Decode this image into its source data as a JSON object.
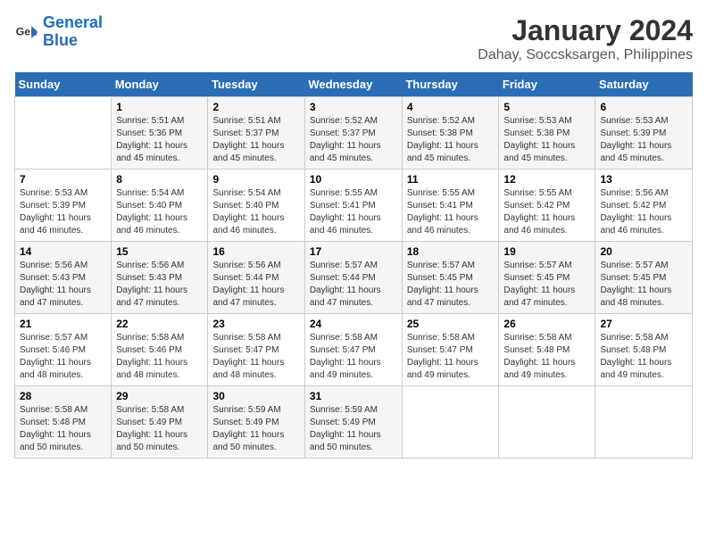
{
  "logo": {
    "line1": "General",
    "line2": "Blue"
  },
  "title": "January 2024",
  "subtitle": "Dahay, Soccsksargen, Philippines",
  "days_of_week": [
    "Sunday",
    "Monday",
    "Tuesday",
    "Wednesday",
    "Thursday",
    "Friday",
    "Saturday"
  ],
  "weeks": [
    [
      {
        "num": "",
        "info": ""
      },
      {
        "num": "1",
        "info": "Sunrise: 5:51 AM\nSunset: 5:36 PM\nDaylight: 11 hours\nand 45 minutes."
      },
      {
        "num": "2",
        "info": "Sunrise: 5:51 AM\nSunset: 5:37 PM\nDaylight: 11 hours\nand 45 minutes."
      },
      {
        "num": "3",
        "info": "Sunrise: 5:52 AM\nSunset: 5:37 PM\nDaylight: 11 hours\nand 45 minutes."
      },
      {
        "num": "4",
        "info": "Sunrise: 5:52 AM\nSunset: 5:38 PM\nDaylight: 11 hours\nand 45 minutes."
      },
      {
        "num": "5",
        "info": "Sunrise: 5:53 AM\nSunset: 5:38 PM\nDaylight: 11 hours\nand 45 minutes."
      },
      {
        "num": "6",
        "info": "Sunrise: 5:53 AM\nSunset: 5:39 PM\nDaylight: 11 hours\nand 45 minutes."
      }
    ],
    [
      {
        "num": "7",
        "info": "Sunrise: 5:53 AM\nSunset: 5:39 PM\nDaylight: 11 hours\nand 46 minutes."
      },
      {
        "num": "8",
        "info": "Sunrise: 5:54 AM\nSunset: 5:40 PM\nDaylight: 11 hours\nand 46 minutes."
      },
      {
        "num": "9",
        "info": "Sunrise: 5:54 AM\nSunset: 5:40 PM\nDaylight: 11 hours\nand 46 minutes."
      },
      {
        "num": "10",
        "info": "Sunrise: 5:55 AM\nSunset: 5:41 PM\nDaylight: 11 hours\nand 46 minutes."
      },
      {
        "num": "11",
        "info": "Sunrise: 5:55 AM\nSunset: 5:41 PM\nDaylight: 11 hours\nand 46 minutes."
      },
      {
        "num": "12",
        "info": "Sunrise: 5:55 AM\nSunset: 5:42 PM\nDaylight: 11 hours\nand 46 minutes."
      },
      {
        "num": "13",
        "info": "Sunrise: 5:56 AM\nSunset: 5:42 PM\nDaylight: 11 hours\nand 46 minutes."
      }
    ],
    [
      {
        "num": "14",
        "info": "Sunrise: 5:56 AM\nSunset: 5:43 PM\nDaylight: 11 hours\nand 47 minutes."
      },
      {
        "num": "15",
        "info": "Sunrise: 5:56 AM\nSunset: 5:43 PM\nDaylight: 11 hours\nand 47 minutes."
      },
      {
        "num": "16",
        "info": "Sunrise: 5:56 AM\nSunset: 5:44 PM\nDaylight: 11 hours\nand 47 minutes."
      },
      {
        "num": "17",
        "info": "Sunrise: 5:57 AM\nSunset: 5:44 PM\nDaylight: 11 hours\nand 47 minutes."
      },
      {
        "num": "18",
        "info": "Sunrise: 5:57 AM\nSunset: 5:45 PM\nDaylight: 11 hours\nand 47 minutes."
      },
      {
        "num": "19",
        "info": "Sunrise: 5:57 AM\nSunset: 5:45 PM\nDaylight: 11 hours\nand 47 minutes."
      },
      {
        "num": "20",
        "info": "Sunrise: 5:57 AM\nSunset: 5:45 PM\nDaylight: 11 hours\nand 48 minutes."
      }
    ],
    [
      {
        "num": "21",
        "info": "Sunrise: 5:57 AM\nSunset: 5:46 PM\nDaylight: 11 hours\nand 48 minutes."
      },
      {
        "num": "22",
        "info": "Sunrise: 5:58 AM\nSunset: 5:46 PM\nDaylight: 11 hours\nand 48 minutes."
      },
      {
        "num": "23",
        "info": "Sunrise: 5:58 AM\nSunset: 5:47 PM\nDaylight: 11 hours\nand 48 minutes."
      },
      {
        "num": "24",
        "info": "Sunrise: 5:58 AM\nSunset: 5:47 PM\nDaylight: 11 hours\nand 49 minutes."
      },
      {
        "num": "25",
        "info": "Sunrise: 5:58 AM\nSunset: 5:47 PM\nDaylight: 11 hours\nand 49 minutes."
      },
      {
        "num": "26",
        "info": "Sunrise: 5:58 AM\nSunset: 5:48 PM\nDaylight: 11 hours\nand 49 minutes."
      },
      {
        "num": "27",
        "info": "Sunrise: 5:58 AM\nSunset: 5:48 PM\nDaylight: 11 hours\nand 49 minutes."
      }
    ],
    [
      {
        "num": "28",
        "info": "Sunrise: 5:58 AM\nSunset: 5:48 PM\nDaylight: 11 hours\nand 50 minutes."
      },
      {
        "num": "29",
        "info": "Sunrise: 5:58 AM\nSunset: 5:49 PM\nDaylight: 11 hours\nand 50 minutes."
      },
      {
        "num": "30",
        "info": "Sunrise: 5:59 AM\nSunset: 5:49 PM\nDaylight: 11 hours\nand 50 minutes."
      },
      {
        "num": "31",
        "info": "Sunrise: 5:59 AM\nSunset: 5:49 PM\nDaylight: 11 hours\nand 50 minutes."
      },
      {
        "num": "",
        "info": ""
      },
      {
        "num": "",
        "info": ""
      },
      {
        "num": "",
        "info": ""
      }
    ]
  ]
}
